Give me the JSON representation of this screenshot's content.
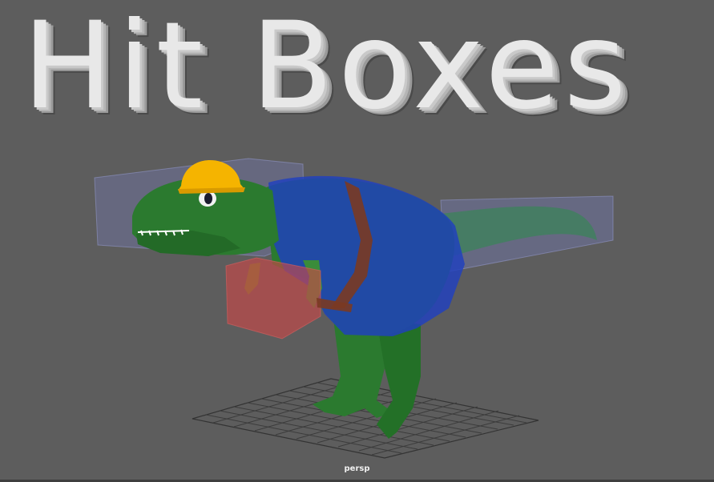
{
  "viewport": {
    "title_text": "Hit Boxes",
    "camera_label": "persp"
  },
  "colors": {
    "background": "#5d5d5d",
    "grid": "#3f3f3f",
    "dino_green": "#2b7a2f",
    "dino_green_dark": "#1f5e23",
    "hitbox_blue": "#2846b8",
    "hitbox_red": "#c84848",
    "helmet_yellow": "#f5b400",
    "strap_brown": "#7a3a22"
  }
}
